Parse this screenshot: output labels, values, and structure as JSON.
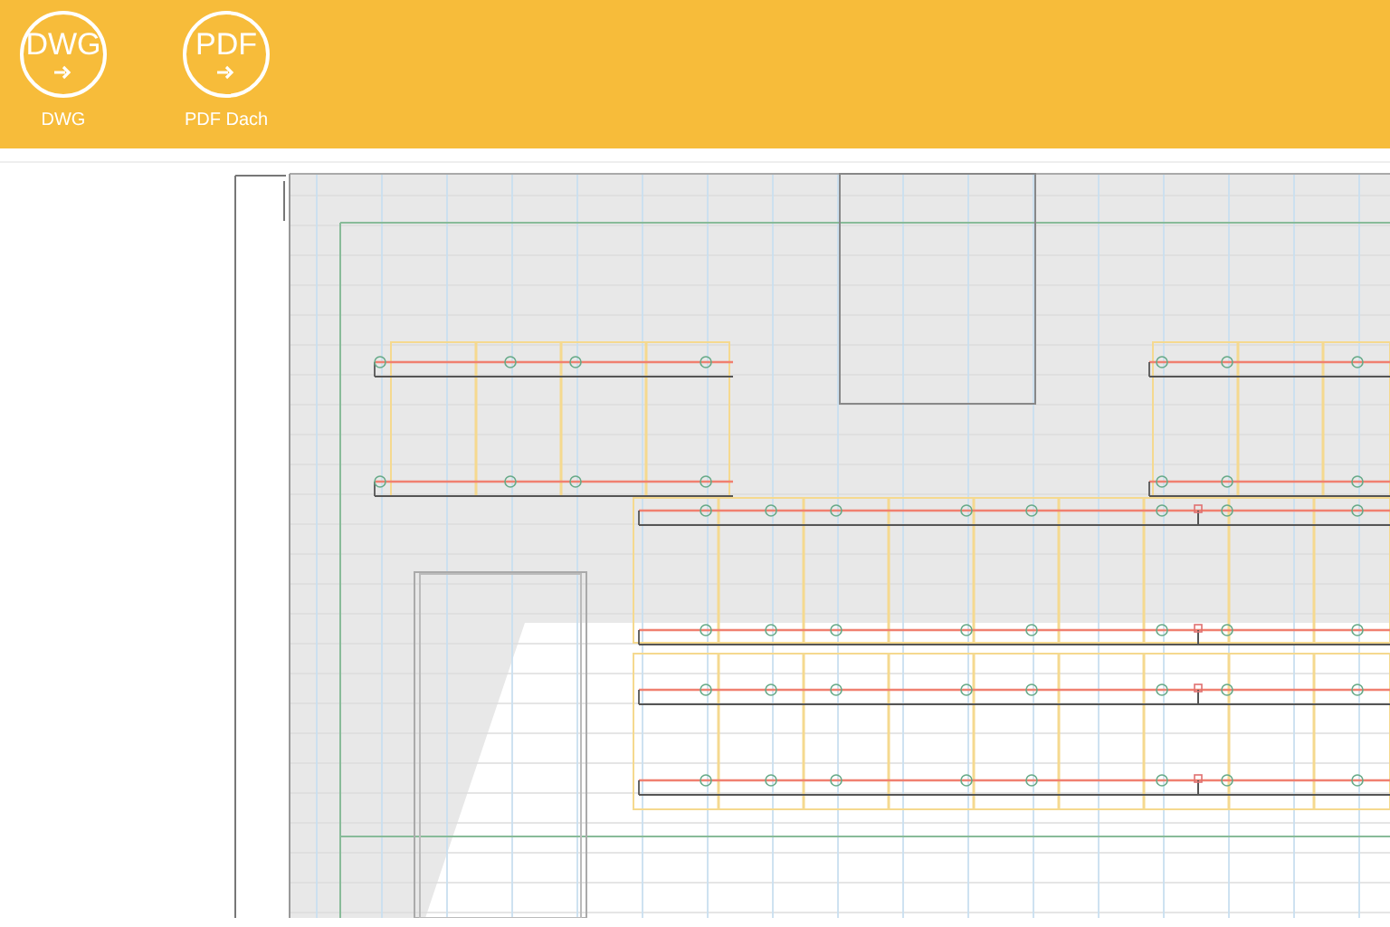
{
  "toolbar": {
    "buttons": [
      {
        "icon_text": "DWG",
        "label": "DWG"
      },
      {
        "icon_text": "PDF",
        "label": "PDF Dach"
      }
    ]
  }
}
